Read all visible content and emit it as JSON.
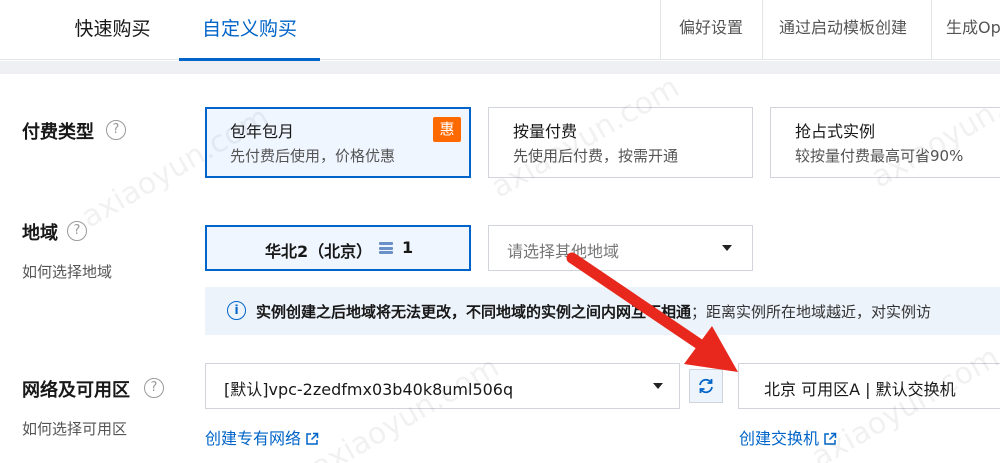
{
  "tabs": [
    {
      "label": "快速购买",
      "active": false
    },
    {
      "label": "自定义购买",
      "active": true
    }
  ],
  "toolbar": {
    "preferences": "偏好设置",
    "from_template": "通过启动模板创建",
    "generate": "生成Op"
  },
  "billing": {
    "label": "付费类型",
    "help": "?",
    "options": [
      {
        "title": "包年包月",
        "desc": "先付费后使用，价格优惠",
        "badge": "惠",
        "selected": true
      },
      {
        "title": "按量付费",
        "desc": "先使用后付费，按需开通",
        "selected": false
      },
      {
        "title": "抢占式实例",
        "desc": "较按量付费最高可省90%",
        "selected": false
      }
    ]
  },
  "region": {
    "label": "地域",
    "help": "?",
    "howto": "如何选择地域",
    "selected_name": "华北2（北京）",
    "zone_count": "1",
    "other_placeholder": "请选择其他地域",
    "notice_bold": "实例创建之后地域将无法更改，不同地域的实例之间内网互不相通",
    "notice_rest": "；距离实例所在地域越近，对实例访"
  },
  "network": {
    "label": "网络及可用区",
    "help": "?",
    "howto": "如何选择可用区",
    "vpc_value": "[默认]vpc-2zedfmx03b40k8uml506q",
    "switch_value": "北京 可用区A | 默认交换机",
    "create_vpc": "创建专有网络",
    "create_switch": "创建交换机"
  },
  "icons": {
    "help": "help-circle-icon",
    "info": "info-circle-icon",
    "refresh": "refresh-icon",
    "external": "external-link-icon",
    "zone": "zone-stack-icon",
    "caret": "caret-down-icon",
    "annotation": "red-arrow-annotation"
  },
  "colors": {
    "primary": "#0064c8",
    "badge": "#ff6a00",
    "arrow": "#e8281c",
    "notice_bg": "#edf3fb"
  }
}
